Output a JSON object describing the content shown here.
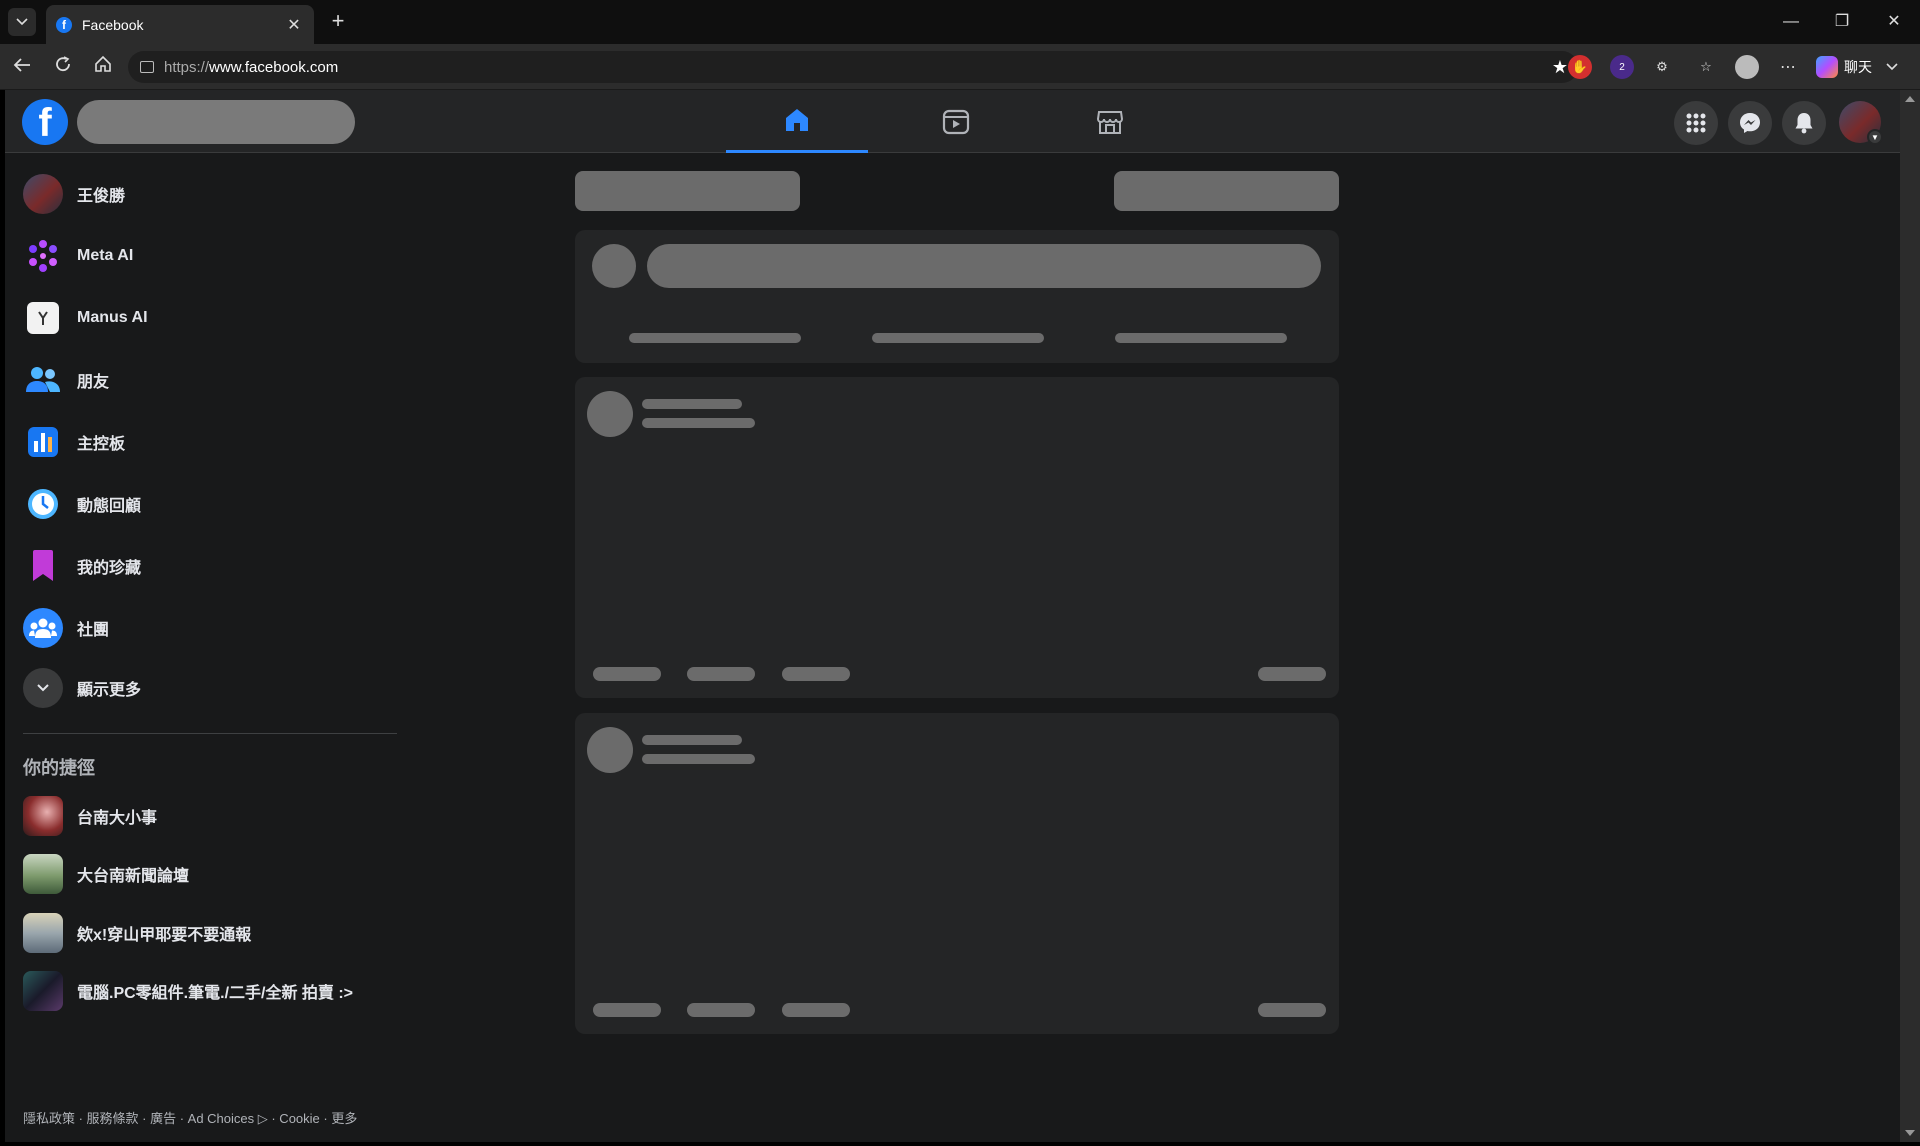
{
  "browser": {
    "tab_title": "Facebook",
    "tab_close": "✕",
    "new_tab": "+",
    "url_prefix": "https://",
    "url_host": "www.facebook.com",
    "chat_label": "聊天",
    "window": {
      "minimize": "—",
      "restore": "❐",
      "close": "✕"
    },
    "ext_badge": "2"
  },
  "topnav": {
    "logo": "f",
    "tabs": [
      {
        "name": "home-tab",
        "active": true
      },
      {
        "name": "video-tab",
        "active": false
      },
      {
        "name": "marketplace-tab",
        "active": false
      }
    ]
  },
  "sidebar": {
    "items": [
      {
        "label": "王俊勝",
        "icon": "profile-avatar"
      },
      {
        "label": "Meta AI",
        "icon": "meta-ai-icon"
      },
      {
        "label": "Manus AI",
        "icon": "manus-ai-icon"
      },
      {
        "label": "朋友",
        "icon": "friends-icon"
      },
      {
        "label": "主控板",
        "icon": "dashboard-icon"
      },
      {
        "label": "動態回顧",
        "icon": "memories-icon"
      },
      {
        "label": "我的珍藏",
        "icon": "saved-icon"
      },
      {
        "label": "社團",
        "icon": "groups-icon"
      },
      {
        "label": "顯示更多",
        "icon": "chevron-down-icon"
      }
    ],
    "shortcuts_title": "你的捷徑",
    "shortcuts": [
      {
        "label": "台南大小事"
      },
      {
        "label": "大台南新聞論壇"
      },
      {
        "label": "欸x!穿山甲耶要不要通報"
      },
      {
        "label": "電腦.PC零組件.筆電./二手/全新 拍賣 :>"
      }
    ],
    "footer": "隱私政策 · 服務條款 · 廣告 · Ad Choices ▷ · Cookie · 更多"
  },
  "colors": {
    "page_bg": "#18191a",
    "surface": "#242526",
    "accent": "#1877f2",
    "active_tab": "#2d88ff",
    "skeleton": "#6b6b6b"
  }
}
